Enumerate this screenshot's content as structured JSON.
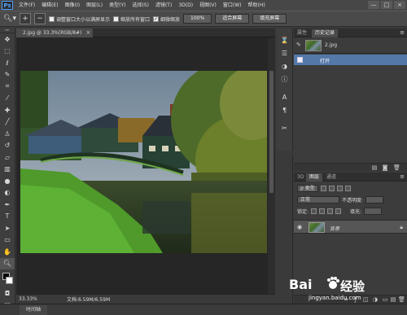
{
  "app": {
    "logo": "Ps"
  },
  "menu": [
    "文件(F)",
    "编辑(E)",
    "图像(I)",
    "图层(L)",
    "类型(Y)",
    "选择(S)",
    "滤镜(T)",
    "3D(D)",
    "视图(V)",
    "窗口(W)",
    "帮助(H)"
  ],
  "window_controls": [
    "—",
    "□",
    "×"
  ],
  "options": {
    "resize_windows_label": "调整窗口大小以满屏显示",
    "resize_windows_checked": false,
    "zoom_all_label": "缩放所有窗口",
    "zoom_all_checked": false,
    "scrubby_zoom_label": "细微缩放",
    "scrubby_zoom_checked": true,
    "zoom_value": "100%",
    "fit_screen_label": "适合屏幕",
    "fill_screen_label": "填充屏幕"
  },
  "document": {
    "tab_title": "2.jpg @ 33.3%(RGB/8#)",
    "close_glyph": "×",
    "status_zoom": "33.33%",
    "status_doc": "文档:6.59M/6.59M"
  },
  "bottom_tab": "时间轴",
  "history_panel": {
    "tabs": [
      "属性",
      "历史记录"
    ],
    "active_tab": 1,
    "snapshot_name": "2.jpg",
    "states": [
      "打开"
    ]
  },
  "layers_panel": {
    "tabs": [
      "3D",
      "图层",
      "通道"
    ],
    "active_tab": 1,
    "filter_label": "ρ 类型",
    "blend_mode": "正常",
    "opacity_label": "不透明度:",
    "lock_label": "锁定:",
    "fill_label": "填充:",
    "layer_name": "背景"
  },
  "watermark": {
    "brand": "Bai",
    "brand2": "经验",
    "url": "jingyan.baidu.com"
  }
}
